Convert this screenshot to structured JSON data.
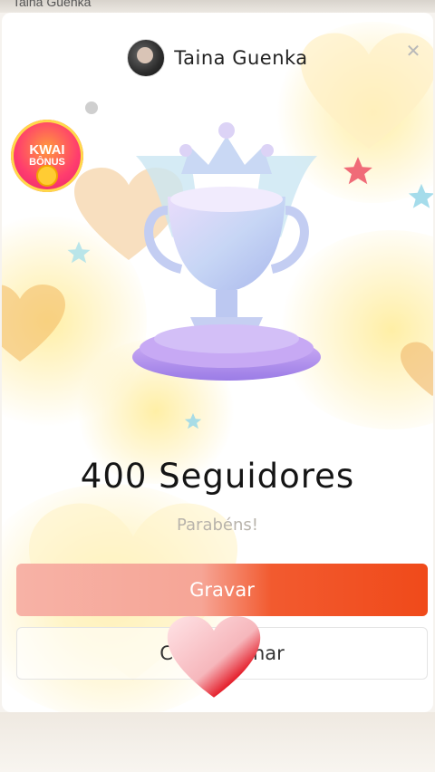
{
  "status_bar": {
    "partial_text": "Taina Guenka"
  },
  "header": {
    "username": "Taina Guenka",
    "close_icon": "close-icon"
  },
  "badge": {
    "line1": "KWAI",
    "line2": "BÔNUS"
  },
  "achievement": {
    "title": "400 Seguidores",
    "subtitle": "Parabéns!"
  },
  "buttons": {
    "record_label": "Gravar",
    "share_label": "Compartilhar"
  },
  "colors": {
    "accent": "#f04a1a",
    "accent_light": "#f7b2a6",
    "trophy": "#b9b6f0",
    "heart": "#e0202a"
  }
}
